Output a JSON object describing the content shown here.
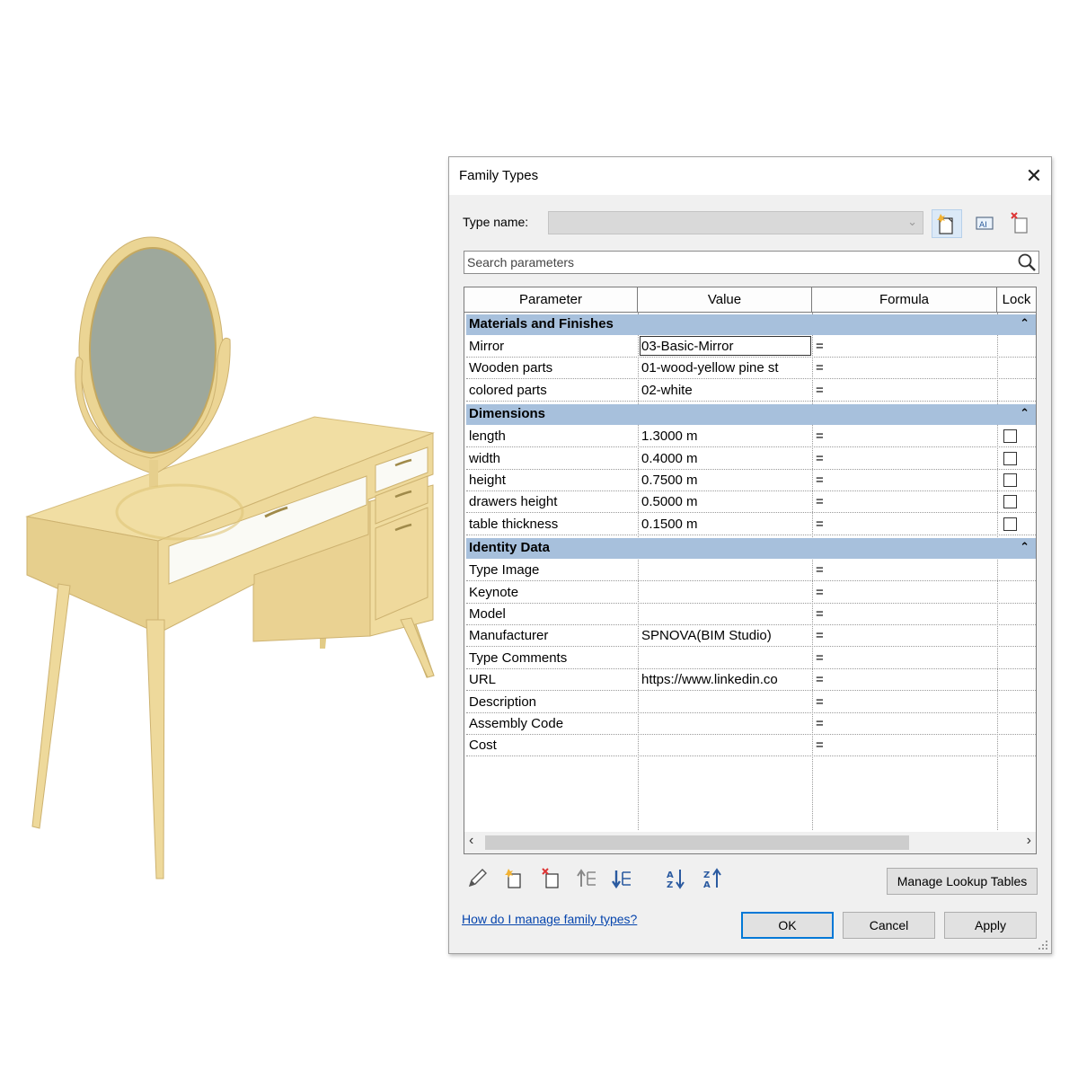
{
  "dialog": {
    "title": "Family Types",
    "close_label": "✕",
    "type_name_label": "Type name:",
    "type_name_value": "",
    "search_placeholder": "Search parameters",
    "columns": [
      "Parameter",
      "Value",
      "Formula",
      "Lock"
    ],
    "groups": [
      {
        "name": "Materials and Finishes",
        "rows": [
          {
            "param": "Mirror",
            "value": "03-Basic-Mirror",
            "formula": "=",
            "lock": false
          },
          {
            "param": "Wooden parts",
            "value": "01-wood-yellow pine st",
            "formula": "=",
            "lock": false
          },
          {
            "param": "colored parts",
            "value": "02-white",
            "formula": "=",
            "lock": false
          }
        ]
      },
      {
        "name": "Dimensions",
        "rows": [
          {
            "param": "length",
            "value": "1.3000 m",
            "formula": "=",
            "lock": true
          },
          {
            "param": "width",
            "value": "0.4000 m",
            "formula": "=",
            "lock": true
          },
          {
            "param": "height",
            "value": "0.7500 m",
            "formula": "=",
            "lock": true
          },
          {
            "param": "drawers height",
            "value": "0.5000 m",
            "formula": "=",
            "lock": true
          },
          {
            "param": "table thickness",
            "value": "0.1500 m",
            "formula": "=",
            "lock": true
          }
        ]
      },
      {
        "name": "Identity Data",
        "rows": [
          {
            "param": "Type Image",
            "value": "",
            "formula": "=",
            "lock": false
          },
          {
            "param": "Keynote",
            "value": "",
            "formula": "=",
            "lock": false
          },
          {
            "param": "Model",
            "value": "",
            "formula": "=",
            "lock": false
          },
          {
            "param": "Manufacturer",
            "value": "SPNOVA(BIM Studio)",
            "formula": "=",
            "lock": false
          },
          {
            "param": "Type Comments",
            "value": "",
            "formula": "=",
            "lock": false
          },
          {
            "param": "URL",
            "value": "https://www.linkedin.co",
            "formula": "=",
            "lock": false
          },
          {
            "param": "Description",
            "value": "",
            "formula": "=",
            "lock": false
          },
          {
            "param": "Assembly Code",
            "value": "",
            "formula": "=",
            "lock": false
          },
          {
            "param": "Cost",
            "value": "",
            "formula": "=",
            "lock": false
          }
        ]
      }
    ],
    "collapse_glyph": "⌃",
    "manage_lookup_label": "Manage Lookup Tables",
    "help_link": "How do I manage family types?",
    "ok_label": "OK",
    "cancel_label": "Cancel",
    "apply_label": "Apply"
  },
  "colors": {
    "group_header": "#a7c0dc",
    "wood": "#ecd79a",
    "mirror": "#9ea89c",
    "drawer_front": "#fafaf5",
    "link": "#0645ad",
    "default_button_border": "#0078d7"
  }
}
